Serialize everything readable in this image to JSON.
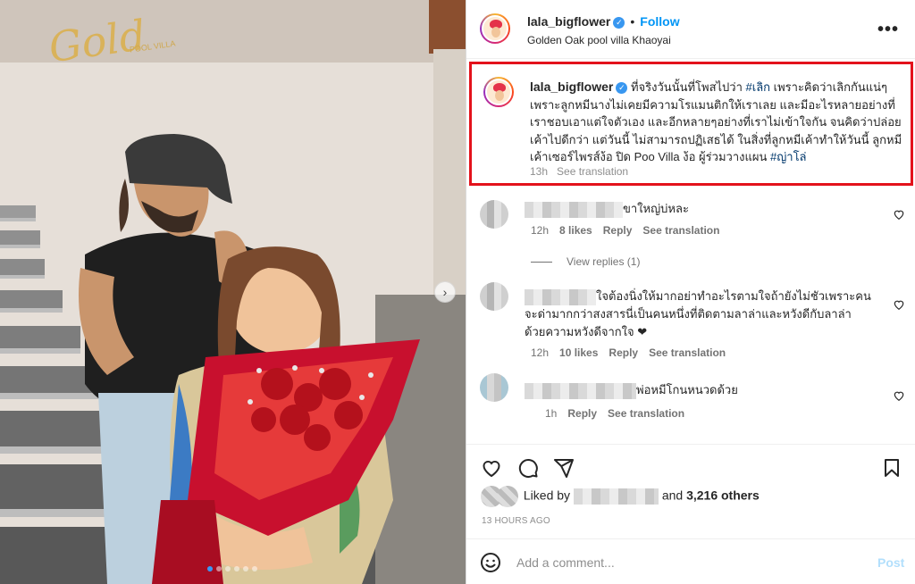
{
  "photo": {
    "sign_text": "Gold",
    "sign_subtext": "POOL VILLA"
  },
  "header": {
    "username": "lala_bigflower",
    "separator": "•",
    "follow_label": "Follow",
    "location": "Golden Oak pool villa Khaoyai",
    "more_label": "•••"
  },
  "caption": {
    "username": "lala_bigflower",
    "text_1": "ที่จริงวันนั้นที่โพสไปว่า ",
    "tag_1": "#เลิก",
    "text_2": " เพราะคิดว่าเลิกกันแน่ๆ เพราะลูกหมีนางไม่เคยมีความโรแมนติกให้เราเลย และมีอะไรหลายอย่างที่เราชอบเอาแต่ใจตัวเอง และอีกหลายๆอย่างที่เราไม่เข้าใจกัน จนคิดว่าปล่อยเค้าไปดีกว่า แต่วันนี้ ไม่สามารถปฏิเสธได้ ในสิ่งที่ลูกหมีเค้าทำให้วันนี้ ลูกหมีเค้าเซอร์ไพรส์ง้อ ปิด Poo Villa ง้อ ผู้ร่วมวางแผน ",
    "tag_2": "#ญ่าโล่",
    "time": "13h",
    "translate": "See translation"
  },
  "comments": [
    {
      "text": "ขาใหญ่บ่หละ",
      "time": "12h",
      "likes": "8 likes",
      "reply": "Reply",
      "translate": "See translation"
    },
    {
      "text_line1": "ใจต้องนิ่งให้มากอย่าทำอะไรตามใจถ้ายังไม่ชัวเพราะคน",
      "text_line2": "จะด่ามากกว่าสงสารนี่เป็นคนหนึ่งที่ติดตามลาล่าและหวังดีกับลาล่า",
      "text_line3": "ด้วยความหวังดีจากใจ ❤",
      "time": "12h",
      "likes": "10 likes",
      "reply": "Reply",
      "translate": "See translation"
    },
    {
      "text": "พ่อหมีโกนหนวดด้วย",
      "time": "1h",
      "reply": "Reply",
      "translate": "See translation"
    }
  ],
  "view_replies": "View replies (1)",
  "likes": {
    "prefix": "Liked by",
    "and": "and",
    "count": "3,216 others"
  },
  "time_ago": "13 HOURS AGO",
  "add_comment": {
    "placeholder": "Add a comment...",
    "post_label": "Post"
  },
  "carousel": {
    "count": 6,
    "active_index": 0
  },
  "colors": {
    "follow": "#0095f6",
    "highlight_border": "#e3121b",
    "heart_red": "#ed1c24"
  }
}
